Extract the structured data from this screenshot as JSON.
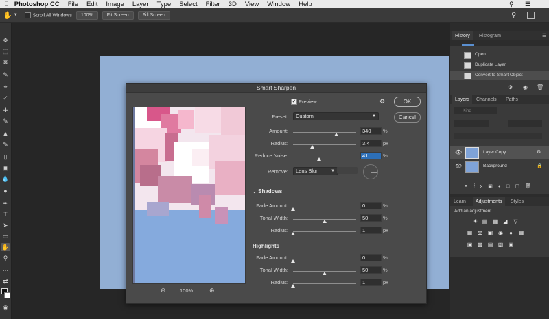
{
  "menubar": {
    "app": "Photoshop CC",
    "items": [
      "File",
      "Edit",
      "Image",
      "Layer",
      "Type",
      "Select",
      "Filter",
      "3D",
      "View",
      "Window",
      "Help"
    ]
  },
  "options_bar": {
    "scroll_all": "Scroll All Windows",
    "zoom": "100%",
    "fit_screen": "Fit Screen",
    "fill_screen": "Fill Screen"
  },
  "dialog": {
    "title": "Smart Sharpen",
    "preview_label": "Preview",
    "preview_checked": true,
    "preview_zoom": "100%",
    "ok": "OK",
    "cancel": "Cancel",
    "preset_label": "Preset:",
    "preset_value": "Custom",
    "amount": {
      "label": "Amount:",
      "value": "340",
      "unit": "%",
      "level": 0.68
    },
    "radius": {
      "label": "Radius:",
      "value": "3.4",
      "unit": "px",
      "level": 0.3
    },
    "reduce_noise": {
      "label": "Reduce Noise:",
      "value": "41",
      "unit": "%",
      "level": 0.41
    },
    "remove_label": "Remove:",
    "remove_value": "Lens Blur",
    "shadows": {
      "title": "Shadows",
      "fade_amount": {
        "label": "Fade Amount:",
        "value": "0",
        "unit": "%",
        "level": 0
      },
      "tonal_width": {
        "label": "Tonal Width:",
        "value": "50",
        "unit": "%",
        "level": 0.5
      },
      "radius": {
        "label": "Radius:",
        "value": "1",
        "unit": "px",
        "level": 0
      }
    },
    "highlights": {
      "title": "Highlights",
      "fade_amount": {
        "label": "Fade Amount:",
        "value": "0",
        "unit": "%",
        "level": 0
      },
      "tonal_width": {
        "label": "Tonal Width:",
        "value": "50",
        "unit": "%",
        "level": 0.5
      },
      "radius": {
        "label": "Radius:",
        "value": "1",
        "unit": "px",
        "level": 0
      }
    }
  },
  "history_panel": {
    "tabs": [
      "History",
      "Histogram"
    ],
    "items": [
      "Open",
      "Duplicate Layer",
      "Convert to Smart Object"
    ]
  },
  "layers_panel": {
    "tabs": [
      "Layers",
      "Channels",
      "Paths"
    ],
    "search_placeholder": "Kind",
    "layers": [
      "Layer Copy",
      "Background"
    ]
  },
  "adjustments_panel": {
    "tabs": [
      "Learn",
      "Adjustments",
      "Styles"
    ],
    "add_label": "Add an adjustment"
  },
  "colors": {
    "canvas": "#92afd4",
    "preview_sky": "#85aadd",
    "highlight": "#2d6fb7",
    "pink": "#d45c8a"
  }
}
